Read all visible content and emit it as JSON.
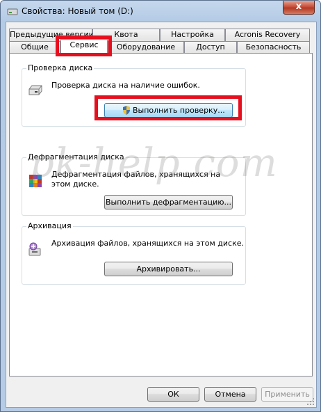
{
  "window": {
    "title": "Свойства: Новый том (D:)",
    "close_glyph": "x"
  },
  "tabs": {
    "row1": [
      "Предыдущие версии",
      "Квота",
      "Настройка",
      "Acronis Recovery"
    ],
    "row2": [
      "Общие",
      "Сервис",
      "Оборудование",
      "Доступ",
      "Безопасность"
    ],
    "active": "Сервис"
  },
  "groups": {
    "check": {
      "title": "Проверка диска",
      "text": "Проверка диска на наличие ошибок.",
      "button": "Выполнить проверку..."
    },
    "defrag": {
      "title": "Дефрагментация диска",
      "text": "Дефрагментация файлов, хранящихся на этом диске.",
      "button": "Выполнить дефрагментацию..."
    },
    "backup": {
      "title": "Архивация",
      "text": "Архивация файлов, хранящихся на этом диске.",
      "button": "Архивировать..."
    }
  },
  "footer": {
    "ok": "ОК",
    "cancel": "Отмена",
    "apply": "Применить"
  },
  "watermark": "pk-help.com",
  "colors": {
    "highlight": "#e60f1e"
  }
}
